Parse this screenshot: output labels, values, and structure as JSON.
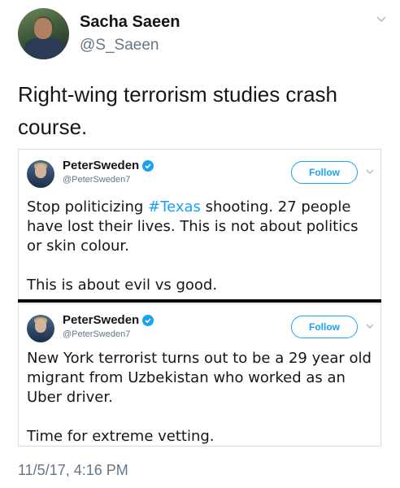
{
  "outer_tweet": {
    "name": "Sacha Saeen",
    "handle": "@S_Saeen",
    "text_line1": "Right-wing terrorism studies crash",
    "text_line2": "course.",
    "timestamp": "11/5/17, 4:16 PM"
  },
  "embedded_tweets": [
    {
      "name": "PeterSweden",
      "handle": "@PeterSweden7",
      "follow_label": "Follow",
      "text_before_hashtag": "Stop politicizing ",
      "hashtag": "#Texas",
      "text_after_hashtag": " shooting. 27 people have lost their lives. This is not about politics or skin colour.",
      "text_para2": "This is about evil vs good."
    },
    {
      "name": "PeterSweden",
      "handle": "@PeterSweden7",
      "follow_label": "Follow",
      "text_para1": "New York terrorist turns out to be a 29 year old migrant from Uzbekistan who worked as an Uber driver.",
      "text_para2": "Time for extreme vetting."
    }
  ],
  "colors": {
    "accent": "#1da1f2",
    "secondary_text": "#657786",
    "primary_text": "#14171a"
  }
}
